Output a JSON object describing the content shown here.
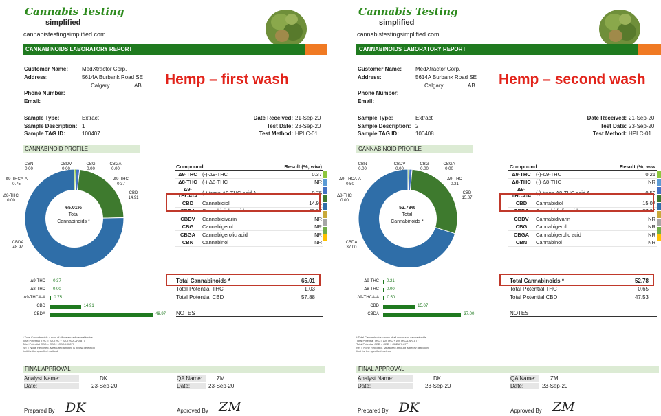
{
  "reports": [
    {
      "brand": "Cannabis Testing",
      "brand_sub": "simplified",
      "site": "cannabistestingsimplified.com",
      "header": "CANNABINOIDS LABORATORY REPORT",
      "overlay_title": "Hemp – first wash",
      "customer_label": "Customer Name:",
      "customer": "MedXtractor Corp.",
      "address_label": "Address:",
      "address1": "5614A Burbank Road SE",
      "city": "Calgary",
      "province": "AB",
      "phone_label": "Phone Number:",
      "email_label": "Email:",
      "sample_type_label": "Sample Type:",
      "sample_type": "Extract",
      "sample_desc_label": "Sample Description:",
      "sample_desc": "1",
      "tag_label": "Sample TAG ID:",
      "tag": "100407",
      "date_received_label": "Date Received:",
      "date_received": "21-Sep-20",
      "test_date_label": "Test Date:",
      "test_date": "23-Sep-20",
      "test_method_label": "Test Method:",
      "test_method": "HPLC-01",
      "profile_label": "CANNABINOID PROFILE",
      "donut": {
        "center_pct": "65.01%",
        "center_l1": "Total",
        "center_l2": "Cannabinoids *",
        "labels": [
          {
            "name": "CBN",
            "value": "0.00"
          },
          {
            "name": "CBDV",
            "value": "0.00"
          },
          {
            "name": "CBG",
            "value": "0.00"
          },
          {
            "name": "CBGA",
            "value": "0.00"
          },
          {
            "name": "Δ9-THC",
            "value": "0.37"
          },
          {
            "name": "Δ9-THCA-A",
            "value": "0.75"
          },
          {
            "name": "Δ8-THC",
            "value": "0.00"
          },
          {
            "name": "CBD",
            "value": "14.91"
          },
          {
            "name": "CBDA",
            "value": "48.97"
          }
        ]
      },
      "table": {
        "h_compound": "Compound",
        "h_result": "Result (%, w/w)",
        "rows": [
          {
            "abbr": "Δ9-THC",
            "name": "(-)-Δ9-THC",
            "value": "0.37",
            "color": "#8dc63f"
          },
          {
            "abbr": "Δ8-THC",
            "name": "(-)-Δ8-THC",
            "value": "NR",
            "color": "#5b9bd5"
          },
          {
            "abbr": "Δ9-THCA-A",
            "name": "(-)-trans-Δ9-THC acid A",
            "value": "0.75",
            "color": "#4472c4"
          },
          {
            "abbr": "CBD",
            "name": "Cannabidiol",
            "value": "14.91",
            "color": "#3e7a2e"
          },
          {
            "abbr": "CBDA",
            "name": "Cannabidiolic acid",
            "value": "48.97",
            "color": "#2f6ea8"
          },
          {
            "abbr": "CBDV",
            "name": "Cannabidivarin",
            "value": "NR",
            "color": "#c8a93a"
          },
          {
            "abbr": "CBG",
            "name": "Cannabigerol",
            "value": "NR",
            "color": "#a6a6a6"
          },
          {
            "abbr": "CBGA",
            "name": "Cannabigerolic acid",
            "value": "NR",
            "color": "#70ad47"
          },
          {
            "abbr": "CBN",
            "name": "Cannabinol",
            "value": "NR",
            "color": "#ffc000"
          }
        ]
      },
      "bars": [
        {
          "name": "Δ9-THC",
          "value": "0.37",
          "n": 0.37
        },
        {
          "name": "Δ8-THC",
          "value": "0.00",
          "n": 0
        },
        {
          "name": "Δ9-THCA-A",
          "value": "0.75",
          "n": 0.75
        },
        {
          "name": "CBD",
          "value": "14.91",
          "n": 14.91
        },
        {
          "name": "CBDA",
          "value": "48.97",
          "n": 48.97
        }
      ],
      "total_label": "Total Cannabinoids *",
      "total": "65.01",
      "thc_label": "Total Potential THC",
      "thc": "1.03",
      "cbd_label": "Total Potential CBD",
      "cbd": "57.88",
      "notes_label": "NOTES",
      "footnotes": [
        "* Total Cannabinoids = sum of all measured cannabinoids",
        "Total Potential THC = Δ9-THC + Δ9-THCA-A*0.877",
        "Total Potential CBD = CBD + CBDA*0.877",
        "NR = None Reported. Measured amount is below detection",
        "limit for the specified method"
      ],
      "approval_label": "FINAL APPROVAL",
      "analyst_label": "Analyst Name:",
      "analyst": "DK",
      "qa_label": "QA Name:",
      "qa": "ZM",
      "date_label": "Date:",
      "date": "23-Sep-20",
      "prepared_label": "Prepared By",
      "prepared_sig": "DK",
      "approved_label": "Approved By",
      "approved_sig": "ZM"
    },
    {
      "brand": "Cannabis Testing",
      "brand_sub": "simplified",
      "site": "cannabistestingsimplified.com",
      "header": "CANNABINOIDS LABORATORY REPORT",
      "overlay_title": "Hemp – second wash",
      "customer_label": "Customer Name:",
      "customer": "MedXtractor Corp.",
      "address_label": "Address:",
      "address1": "5614A Burbank Road SE",
      "city": "Calgary",
      "province": "AB",
      "phone_label": "Phone Number:",
      "email_label": "Email:",
      "sample_type_label": "Sample Type:",
      "sample_type": "Extract",
      "sample_desc_label": "Sample Description:",
      "sample_desc": "2",
      "tag_label": "Sample TAG ID:",
      "tag": "100408",
      "date_received_label": "Date Received:",
      "date_received": "21-Sep-20",
      "test_date_label": "Test Date:",
      "test_date": "23-Sep-20",
      "test_method_label": "Test Method:",
      "test_method": "HPLC-01",
      "profile_label": "CANNABINOID PROFILE",
      "donut": {
        "center_pct": "52.78%",
        "center_l1": "Total",
        "center_l2": "Cannabinoids *",
        "labels": [
          {
            "name": "CBN",
            "value": "0.00"
          },
          {
            "name": "CBDV",
            "value": "0.00"
          },
          {
            "name": "CBG",
            "value": "0.00"
          },
          {
            "name": "CBGA",
            "value": "0.00"
          },
          {
            "name": "Δ9-THC",
            "value": "0.21"
          },
          {
            "name": "Δ9-THCA-A",
            "value": "0.50"
          },
          {
            "name": "Δ8-THC",
            "value": "0.00"
          },
          {
            "name": "CBD",
            "value": "15.07"
          },
          {
            "name": "CBDA",
            "value": "37.00"
          }
        ]
      },
      "table": {
        "h_compound": "Compound",
        "h_result": "Result (%, w/w",
        "rows": [
          {
            "abbr": "Δ9-THC",
            "name": "(-)-Δ9-THC",
            "value": "0.21",
            "color": "#8dc63f"
          },
          {
            "abbr": "Δ8-THC",
            "name": "(-)-Δ8-THC",
            "value": "NR",
            "color": "#5b9bd5"
          },
          {
            "abbr": "Δ9-THCA-A",
            "name": "(-)-trans-Δ9-THC acid A",
            "value": "0.50",
            "color": "#4472c4"
          },
          {
            "abbr": "CBD",
            "name": "Cannabidiol",
            "value": "15.07",
            "color": "#3e7a2e"
          },
          {
            "abbr": "CBDA",
            "name": "Cannabidiolic acid",
            "value": "37.00",
            "color": "#2f6ea8"
          },
          {
            "abbr": "CBDV",
            "name": "Cannabidivarin",
            "value": "NR",
            "color": "#c8a93a"
          },
          {
            "abbr": "CBG",
            "name": "Cannabigerol",
            "value": "NR",
            "color": "#a6a6a6"
          },
          {
            "abbr": "CBGA",
            "name": "Cannabigerolic acid",
            "value": "NR",
            "color": "#70ad47"
          },
          {
            "abbr": "CBN",
            "name": "Cannabinol",
            "value": "NR",
            "color": "#ffc000"
          }
        ]
      },
      "bars": [
        {
          "name": "Δ9-THC",
          "value": "0.21",
          "n": 0.21
        },
        {
          "name": "Δ8-THC",
          "value": "0.00",
          "n": 0
        },
        {
          "name": "Δ9-THCA-A",
          "value": "0.50",
          "n": 0.5
        },
        {
          "name": "CBD",
          "value": "15.07",
          "n": 15.07
        },
        {
          "name": "CBDA",
          "value": "37.00",
          "n": 37.0
        }
      ],
      "total_label": "Total Cannabinoids *",
      "total": "52.78",
      "thc_label": "Total Potential THC",
      "thc": "0.65",
      "cbd_label": "Total Potential CBD",
      "cbd": "47.53",
      "notes_label": "NOTES",
      "footnotes": [
        "* Total Cannabinoids = sum of all measured cannabinoids",
        "Total Potential THC = Δ9-THC + Δ9-THCA-A*0.877",
        "Total Potential CBD = CBD + CBDA*0.877",
        "NR = None Reported. Measured amount is below detection",
        "limit for the specified method"
      ],
      "approval_label": "FINAL APPROVAL",
      "analyst_label": "Analyst Name:",
      "analyst": "DK",
      "qa_label": "QA Name:",
      "qa": "ZM",
      "date_label": "Date:",
      "date": "23-Sep-20",
      "prepared_label": "Prepared By",
      "prepared_sig": "DK",
      "approved_label": "Approved By",
      "approved_sig": "ZM"
    }
  ],
  "chart_data": [
    {
      "type": "pie",
      "title": "CANNABINOID PROFILE",
      "categories": [
        "CBN",
        "CBDV",
        "CBG",
        "CBGA",
        "Δ9-THC",
        "Δ9-THCA-A",
        "Δ8-THC",
        "CBD",
        "CBDA"
      ],
      "values": [
        0,
        0,
        0,
        0,
        0.37,
        0.75,
        0,
        14.91,
        48.97
      ]
    },
    {
      "type": "bar",
      "categories": [
        "Δ9-THC",
        "Δ8-THC",
        "Δ9-THCA-A",
        "CBD",
        "CBDA"
      ],
      "values": [
        0.37,
        0,
        0.75,
        14.91,
        48.97
      ]
    },
    {
      "type": "pie",
      "title": "CANNABINOID PROFILE",
      "categories": [
        "CBN",
        "CBDV",
        "CBG",
        "CBGA",
        "Δ9-THC",
        "Δ9-THCA-A",
        "Δ8-THC",
        "CBD",
        "CBDA"
      ],
      "values": [
        0,
        0,
        0,
        0,
        0.21,
        0.5,
        0,
        15.07,
        37.0
      ]
    },
    {
      "type": "bar",
      "categories": [
        "Δ9-THC",
        "Δ8-THC",
        "Δ9-THCA-A",
        "CBD",
        "CBDA"
      ],
      "values": [
        0.21,
        0,
        0.5,
        15.07,
        37.0
      ]
    }
  ]
}
